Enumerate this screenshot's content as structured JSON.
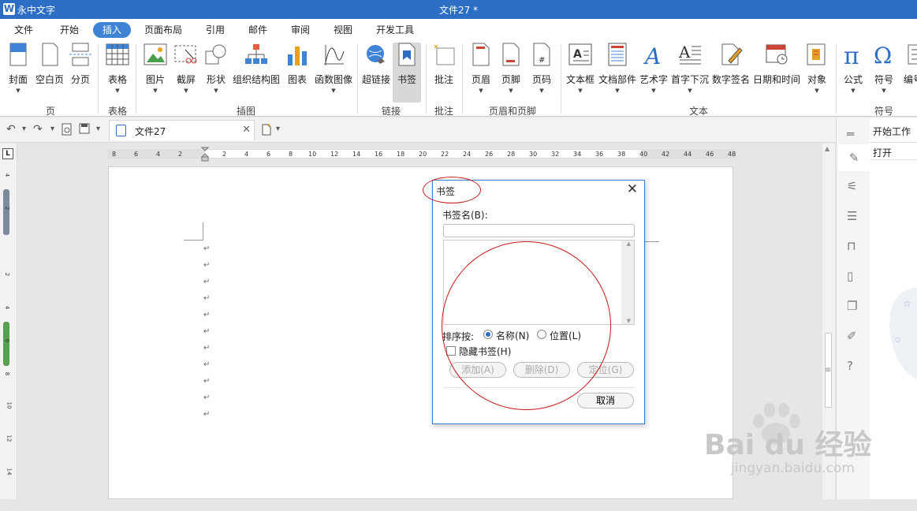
{
  "titlebar": {
    "logo": "W",
    "app_name": "永中文字",
    "doc_title": "文件27 *"
  },
  "menu": [
    "文件",
    "开始",
    "插入",
    "页面布局",
    "引用",
    "邮件",
    "审阅",
    "视图",
    "开发工具"
  ],
  "ribbon": {
    "buttons": [
      {
        "label": "封面",
        "icon": "cover-icon"
      },
      {
        "label": "空白页",
        "icon": "blank-page-icon"
      },
      {
        "label": "分页",
        "icon": "page-break-icon"
      },
      {
        "label": "表格",
        "icon": "table-icon"
      },
      {
        "label": "图片",
        "icon": "picture-icon"
      },
      {
        "label": "截屏",
        "icon": "screenshot-icon"
      },
      {
        "label": "形状",
        "icon": "shape-icon"
      },
      {
        "label": "组织结构图",
        "icon": "org-chart-icon"
      },
      {
        "label": "图表",
        "icon": "chart-icon"
      },
      {
        "label": "函数图像",
        "icon": "function-graph-icon"
      },
      {
        "label": "超链接",
        "icon": "hyperlink-icon"
      },
      {
        "label": "书签",
        "icon": "bookmark-icon"
      },
      {
        "label": "批注",
        "icon": "comment-icon"
      },
      {
        "label": "页眉",
        "icon": "header-icon"
      },
      {
        "label": "页脚",
        "icon": "footer-icon"
      },
      {
        "label": "页码",
        "icon": "page-number-icon"
      },
      {
        "label": "文本框",
        "icon": "text-box-icon"
      },
      {
        "label": "文档部件",
        "icon": "doc-parts-icon"
      },
      {
        "label": "艺术字",
        "icon": "word-art-icon"
      },
      {
        "label": "首字下沉",
        "icon": "drop-cap-icon"
      },
      {
        "label": "数字签名",
        "icon": "signature-icon"
      },
      {
        "label": "日期和时间",
        "icon": "date-time-icon"
      },
      {
        "label": "对象",
        "icon": "object-icon"
      },
      {
        "label": "公式",
        "icon": "formula-icon"
      },
      {
        "label": "符号",
        "icon": "symbol-icon"
      },
      {
        "label": "编号",
        "icon": "numbering-icon"
      }
    ],
    "groups": [
      "页",
      "表格",
      "插图",
      "链接",
      "批注",
      "页眉和页脚",
      "文本",
      "符号"
    ],
    "dropdown_glyph": "▼"
  },
  "toolbar": {
    "undo": "↶",
    "redo": "↷",
    "caret": "▾",
    "tab_name": "文件27",
    "tab_close": "✕"
  },
  "ruler": {
    "h_numbers": [
      "8",
      "6",
      "4",
      "2",
      "2",
      "4",
      "6",
      "8",
      "10",
      "12",
      "14",
      "16",
      "18",
      "20",
      "22",
      "24",
      "26",
      "28",
      "30",
      "32",
      "34",
      "36",
      "38",
      "40",
      "42",
      "44",
      "46",
      "48"
    ],
    "v_numbers": [
      "4",
      "2",
      "2",
      "4",
      "6",
      "8",
      "10",
      "12",
      "14"
    ],
    "corner": "L"
  },
  "document": {
    "para_mark": "↵"
  },
  "sidebar": {
    "title": "开始工作",
    "open": "打开"
  },
  "dialog": {
    "title": "书签",
    "close": "✕",
    "name_label": "书签名(B):",
    "name_value": "",
    "sort_label": "排序按:",
    "radio_name": "名称(N)",
    "radio_position": "位置(L)",
    "hide_label": "隐藏书签(H)",
    "add": "添加(A)",
    "delete": "删除(D)",
    "locate": "定位(G)",
    "cancel": "取消"
  },
  "watermark": {
    "brand": "Bai du 经验",
    "url": "jingyan.baidu.com"
  },
  "colors": {
    "accent": "#2b6ec4",
    "annotation": "#c81818"
  }
}
